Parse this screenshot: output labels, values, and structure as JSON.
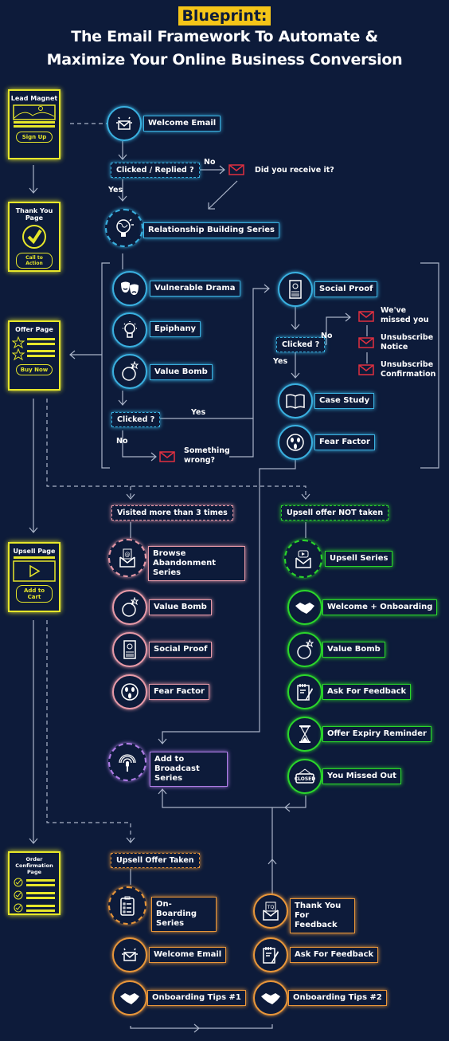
{
  "header": {
    "badge": "Blueprint:",
    "line1": "The Email Framework To Automate &",
    "line2": "Maximize Your Online Business Conversion"
  },
  "pages": {
    "lead_magnet": {
      "title": "Lead Magnet",
      "button": "Sign Up"
    },
    "thank_you": {
      "title": "Thank You Page",
      "button": "Call to Action"
    },
    "offer": {
      "title": "Offer Page",
      "button": "Buy Now"
    },
    "upsell": {
      "title": "Upsell Page",
      "button": "Add to Cart"
    },
    "order": {
      "title": "Order Confirmation Page"
    }
  },
  "flow1": {
    "welcome": "Welcome Email",
    "decision": "Clicked / Replied ?",
    "no": "No",
    "yes": "Yes",
    "did_receive": "Did you receive it?",
    "relationship": "Relationship Building Series"
  },
  "flow2": {
    "vulnerable": "Vulnerable Drama",
    "epiphany": "Epiphany",
    "value_bomb": "Value Bomb",
    "decision": "Clicked ?",
    "yes": "Yes",
    "no": "No",
    "something_wrong": "Something wrong?"
  },
  "flow3": {
    "social_proof": "Social Proof",
    "decision": "Clicked ?",
    "no": "No",
    "yes": "Yes",
    "missed": "We've missed you",
    "unsub_notice": "Unsubscribe Notice",
    "unsub_confirm": "Unsubscribe Confirmation",
    "case_study": "Case Study",
    "fear": "Fear Factor"
  },
  "browse": {
    "condition": "Visited more than 3 times",
    "items": [
      "Browse Abandonment Series",
      "Value Bomb",
      "Social Proof",
      "Fear Factor"
    ]
  },
  "upsell_not": {
    "condition": "Upsell offer NOT taken",
    "items": [
      "Upsell Series",
      "Welcome + Onboarding",
      "Value Bomb",
      "Ask For Feedback",
      "Offer Expiry Reminder",
      "You Missed Out"
    ],
    "closed_sign": "CLOSED"
  },
  "broadcast": {
    "label": "Add to Broadcast Series"
  },
  "upsell_taken": {
    "condition": "Upsell Offer Taken",
    "left": [
      "On-Boarding Series",
      "Welcome Email",
      "Onboarding Tips #1"
    ],
    "right": [
      "Thank You For Feedback",
      "Ask For Feedback",
      "Onboarding Tips #2"
    ],
    "tq": "TQ"
  }
}
